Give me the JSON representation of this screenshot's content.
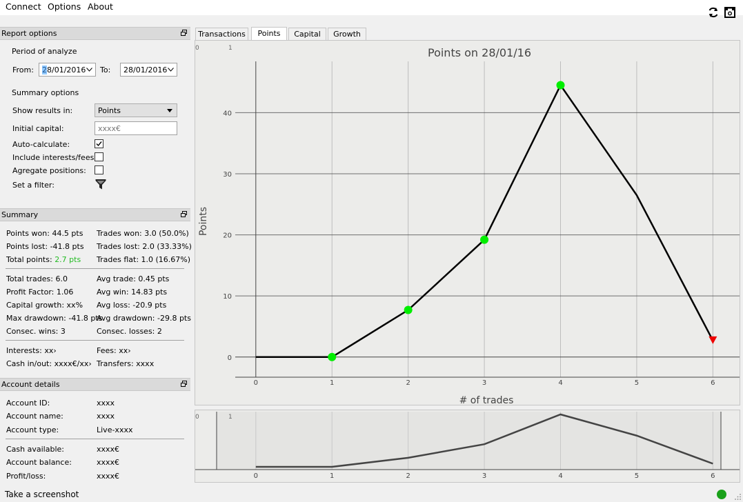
{
  "menu": {
    "connect": "Connect",
    "options": "Options",
    "about": "About"
  },
  "toolbar": {
    "refresh_icon": "refresh-icon",
    "camera_icon": "camera-icon"
  },
  "report_options": {
    "title": "Report options",
    "period_label": "Period of analyze",
    "from_label": "From:",
    "from_value": "28/01/2016",
    "to_label": "To:",
    "to_value": "28/01/2016",
    "summary_options_label": "Summary options",
    "show_results_label": "Show results in:",
    "show_results_value": "Points",
    "initial_capital_label": "Initial capital:",
    "initial_capital_placeholder": "xxxx€",
    "auto_calc_label": "Auto-calculate:",
    "auto_calc_checked": true,
    "include_interests_label": "Include interests/fees:",
    "include_interests_checked": false,
    "aggregate_label": "Agregate positions:",
    "aggregate_checked": false,
    "filter_label": "Set a filter:"
  },
  "summary": {
    "title": "Summary",
    "points_won": "Points won: 44.5 pts",
    "points_lost": "Points lost: -41.8 pts",
    "total_points_label": "Total points: ",
    "total_points_value": "2.7 pts",
    "trades_won": "Trades won: 3.0 (50.0%)",
    "trades_lost": "Trades lost: 2.0 (33.33%)",
    "trades_flat": "Trades flat: 1.0 (16.67%)",
    "total_trades": "Total trades: 6.0",
    "profit_factor": "Profit Factor: 1.06",
    "capital_growth": "Capital growth: xx%",
    "max_drawdown": "Max drawdown: -41.8 pts",
    "consec_wins": "Consec. wins: 3",
    "avg_trade": "Avg trade: 0.45 pts",
    "avg_win": "Avg win: 14.83 pts",
    "avg_loss": "Avg loss: -20.9 pts",
    "avg_drawdown": "Avg drawdown: -29.8 pts",
    "consec_losses": "Consec. losses: 2",
    "interests": "Interests: xx›",
    "cash_in_out": "Cash in/out: xxxx€/xx›",
    "fees": "Fees: xx›",
    "transfers": "Transfers: xxxx"
  },
  "account": {
    "title": "Account details",
    "id_label": "Account ID:",
    "id_value": "xxxx",
    "name_label": "Account name:",
    "name_value": "xxxx",
    "type_label": "Account type:",
    "type_value": "Live-xxxx",
    "cash_label": "Cash available:",
    "cash_value": "xxxx€",
    "balance_label": "Account balance:",
    "balance_value": "xxxx€",
    "pl_label": "Profit/loss:",
    "pl_value": "xxxx€"
  },
  "status": {
    "screenshot_text": "Take a screenshot",
    "connection_color": "#1aa11a"
  },
  "tabs": [
    {
      "label": "Transactions",
      "active": false
    },
    {
      "label": "Points",
      "active": true
    },
    {
      "label": "Capital",
      "active": false
    },
    {
      "label": "Growth",
      "active": false
    }
  ],
  "chart_data": {
    "type": "line",
    "title": "Points on 28/01/16",
    "xlabel": "# of trades",
    "ylabel": "Points",
    "x": [
      0,
      1,
      2,
      3,
      4,
      5,
      6
    ],
    "y": [
      0,
      0,
      7.7,
      19.2,
      44.5,
      26.5,
      2.7
    ],
    "markers": [
      "none",
      "up",
      "up",
      "up",
      "up",
      "none",
      "down"
    ],
    "up_color": "#00ee00",
    "down_color": "#ee0000",
    "line_color": "#000000",
    "xlim": [
      -0.27,
      6.35
    ],
    "ylim": [
      -3.3,
      48.4
    ],
    "x_ticks": [
      0,
      1,
      2,
      3,
      4,
      5,
      6
    ],
    "y_ticks": [
      0,
      10,
      20,
      30,
      40
    ],
    "corner_labels": [
      "0",
      "1"
    ],
    "navigator": {
      "x": [
        0,
        1,
        2,
        3,
        4,
        5,
        6
      ],
      "y": [
        0,
        0,
        7.7,
        19.2,
        44.5,
        26.5,
        2.7
      ],
      "x_ticks": [
        0,
        1,
        2,
        3,
        4,
        5,
        6
      ],
      "corner_labels": [
        "0",
        "1"
      ]
    }
  }
}
